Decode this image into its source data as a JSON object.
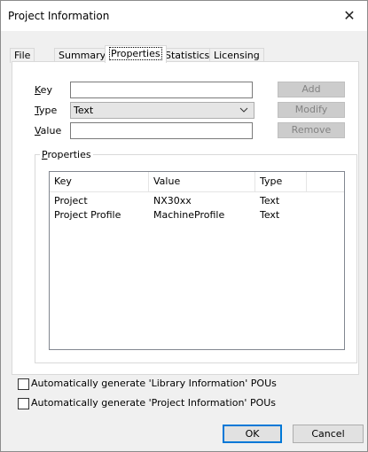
{
  "window": {
    "title": "Project Information",
    "close_glyph": "✕",
    "close_icon": "close-icon"
  },
  "tabs": [
    {
      "label": "File",
      "active": false
    },
    {
      "label": "Summary",
      "active": false
    },
    {
      "label": "Properties",
      "active": true
    },
    {
      "label": "Statistics",
      "active": false
    },
    {
      "label": "Licensing",
      "active": false
    }
  ],
  "form": {
    "key_label_u": "K",
    "key_label_rest": "ey",
    "key_value": "",
    "type_label_u": "T",
    "type_label_rest": "ype",
    "type_value": "Text",
    "type_arrow": "chevron-down-icon",
    "value_label_u": "V",
    "value_label_rest": "alue",
    "value_value": ""
  },
  "side_buttons": {
    "add": "Add",
    "modify": "Modify",
    "remove": "Remove"
  },
  "properties_group": {
    "legend_u": "P",
    "legend_rest": "roperties",
    "columns": [
      "Key",
      "Value",
      "Type"
    ],
    "rows": [
      {
        "key": "Project",
        "value": "NX30xx",
        "type": "Text"
      },
      {
        "key": "Project Profile",
        "value": "MachineProfile",
        "type": "Text"
      }
    ]
  },
  "options": {
    "library_info": "Automatically generate 'Library Information' POUs",
    "library_info_checked": false,
    "project_info": "Automatically generate 'Project Information' POUs",
    "project_info_checked": false
  },
  "footer": {
    "ok": "OK",
    "cancel": "Cancel"
  }
}
